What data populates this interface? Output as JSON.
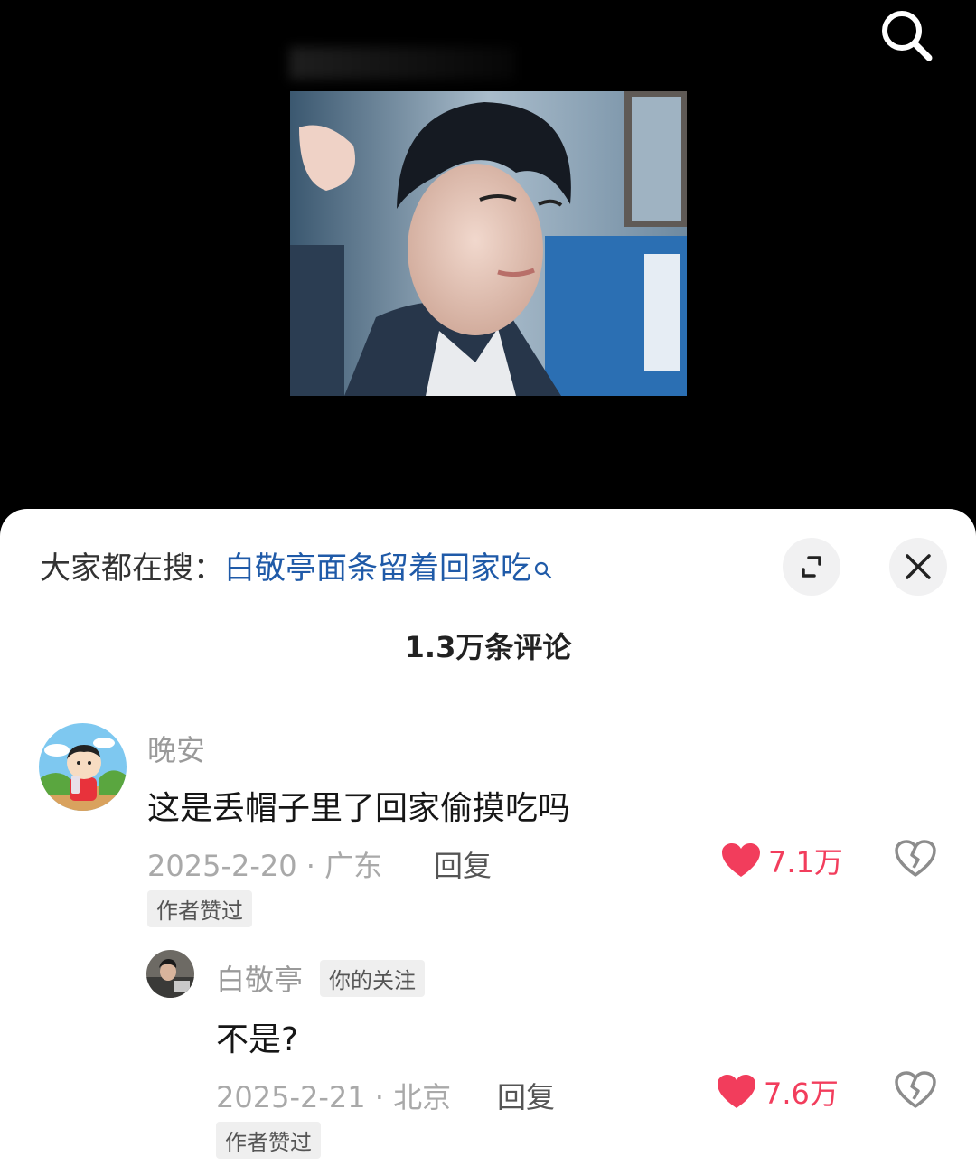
{
  "video": {
    "search_icon": "search-icon"
  },
  "sheet": {
    "hot_search_prefix": "大家都在搜：",
    "hot_search_term": "白敬亭面条留着回家吃",
    "expand_icon": "expand-icon",
    "close_icon": "close-icon",
    "comment_count_title": "1.3万条评论"
  },
  "comments": [
    {
      "username": "晚安",
      "text": "这是丢帽子里了回家偷摸吃吗",
      "meta": "2025-2-20 · 广东",
      "reply_label": "回复",
      "likes": "7.1万",
      "badge": "作者赞过"
    }
  ],
  "replies": [
    {
      "username": "白敬亭",
      "follow_badge": "你的关注",
      "text": "不是?",
      "meta": "2025-2-21 · 北京",
      "reply_label": "回复",
      "likes": "7.6万",
      "badge": "作者赞过"
    }
  ],
  "colors": {
    "like": "#f23d5c",
    "hot_term": "#1f5aa8"
  }
}
